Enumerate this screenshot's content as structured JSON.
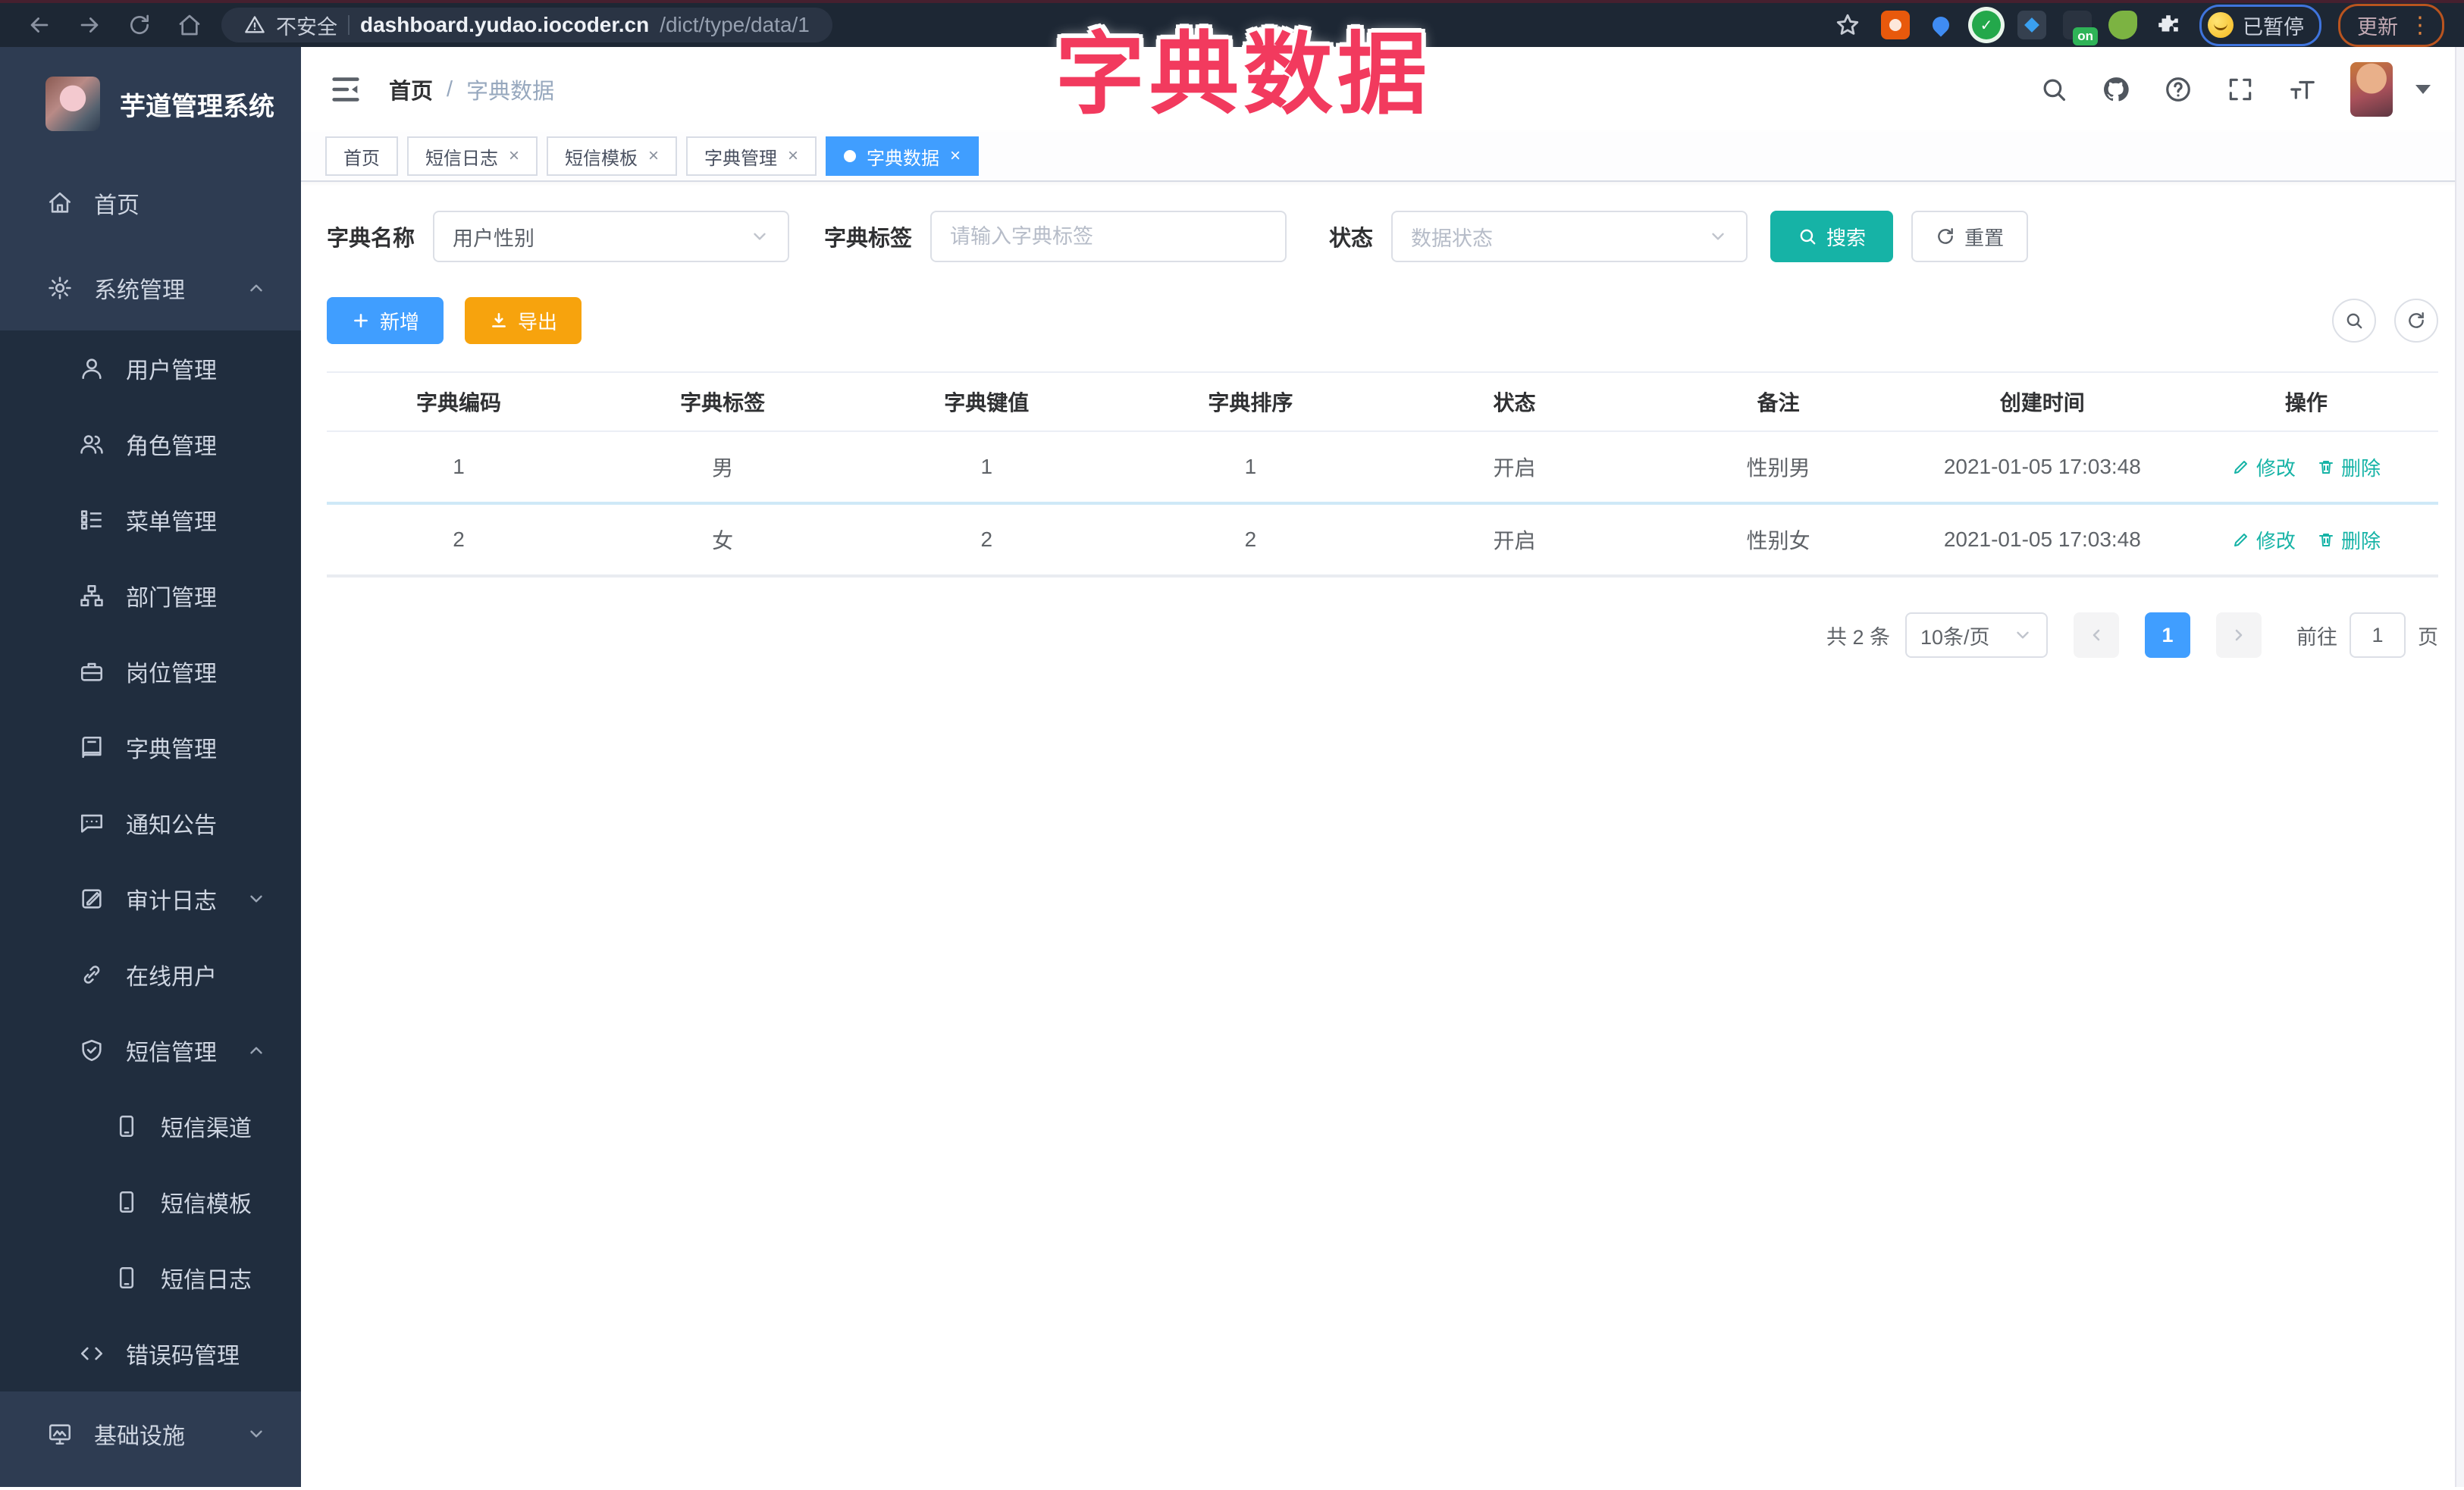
{
  "browser": {
    "security_label": "不安全",
    "url_host": "dashboard.yudao.iocoder.cn",
    "url_path": "/dict/type/data/1",
    "extension_on_badge": "on",
    "paused_label": "已暂停",
    "update_label": "更新"
  },
  "overlay_title": "字典数据",
  "sidebar": {
    "logo_title": "芋道管理系统",
    "items": [
      {
        "label": "首页",
        "icon": "home-icon",
        "level": 1
      },
      {
        "label": "系统管理",
        "icon": "gear-icon",
        "level": 1,
        "expanded": true
      },
      {
        "label": "用户管理",
        "icon": "user-icon",
        "level": 2
      },
      {
        "label": "角色管理",
        "icon": "users-icon",
        "level": 2
      },
      {
        "label": "菜单管理",
        "icon": "list-icon",
        "level": 2
      },
      {
        "label": "部门管理",
        "icon": "tree-icon",
        "level": 2
      },
      {
        "label": "岗位管理",
        "icon": "briefcase-icon",
        "level": 2
      },
      {
        "label": "字典管理",
        "icon": "book-icon",
        "level": 2
      },
      {
        "label": "通知公告",
        "icon": "chat-icon",
        "level": 2
      },
      {
        "label": "审计日志",
        "icon": "audit-icon",
        "level": 2,
        "expanded": false
      },
      {
        "label": "在线用户",
        "icon": "link-icon",
        "level": 2
      },
      {
        "label": "短信管理",
        "icon": "shield-icon",
        "level": 2,
        "expanded": true
      },
      {
        "label": "短信渠道",
        "icon": "phone-icon",
        "level": 3
      },
      {
        "label": "短信模板",
        "icon": "phone-icon",
        "level": 3
      },
      {
        "label": "短信日志",
        "icon": "phone-icon",
        "level": 3
      },
      {
        "label": "错误码管理",
        "icon": "code-icon",
        "level": 2
      },
      {
        "label": "基础设施",
        "icon": "monitor-icon",
        "level": 1,
        "expanded": false
      }
    ]
  },
  "header": {
    "breadcrumb": {
      "home": "首页",
      "current": "字典数据"
    }
  },
  "tabs": [
    {
      "label": "首页",
      "closable": false,
      "active": false
    },
    {
      "label": "短信日志",
      "closable": true,
      "active": false
    },
    {
      "label": "短信模板",
      "closable": true,
      "active": false
    },
    {
      "label": "字典管理",
      "closable": true,
      "active": false
    },
    {
      "label": "字典数据",
      "closable": true,
      "active": true
    }
  ],
  "filters": {
    "name_label": "字典名称",
    "name_value": "用户性别",
    "tag_label": "字典标签",
    "tag_placeholder": "请输入字典标签",
    "status_label": "状态",
    "status_placeholder": "数据状态",
    "search_label": "搜索",
    "reset_label": "重置"
  },
  "actions": {
    "add_label": "新增",
    "export_label": "导出"
  },
  "table": {
    "headers": [
      "字典编码",
      "字典标签",
      "字典键值",
      "字典排序",
      "状态",
      "备注",
      "创建时间",
      "操作"
    ],
    "rows": [
      [
        "1",
        "男",
        "1",
        "1",
        "开启",
        "性别男",
        "2021-01-05 17:03:48"
      ],
      [
        "2",
        "女",
        "2",
        "2",
        "开启",
        "性别女",
        "2021-01-05 17:03:48"
      ]
    ],
    "edit_label": "修改",
    "delete_label": "删除"
  },
  "pagination": {
    "total_text": "共 2 条",
    "page_size": "10条/页",
    "current_page": "1",
    "goto_label": "前往",
    "goto_value": "1",
    "page_unit": "页"
  },
  "colors": {
    "accent_blue": "#409eff",
    "teal_action": "#16b3a6",
    "export_amber": "#f7a30d",
    "sidebar_bg": "#2e3c52",
    "submenu_bg": "#202d3e",
    "overlay_pink": "#f23a5e",
    "browser_bar": "#1d2734"
  }
}
